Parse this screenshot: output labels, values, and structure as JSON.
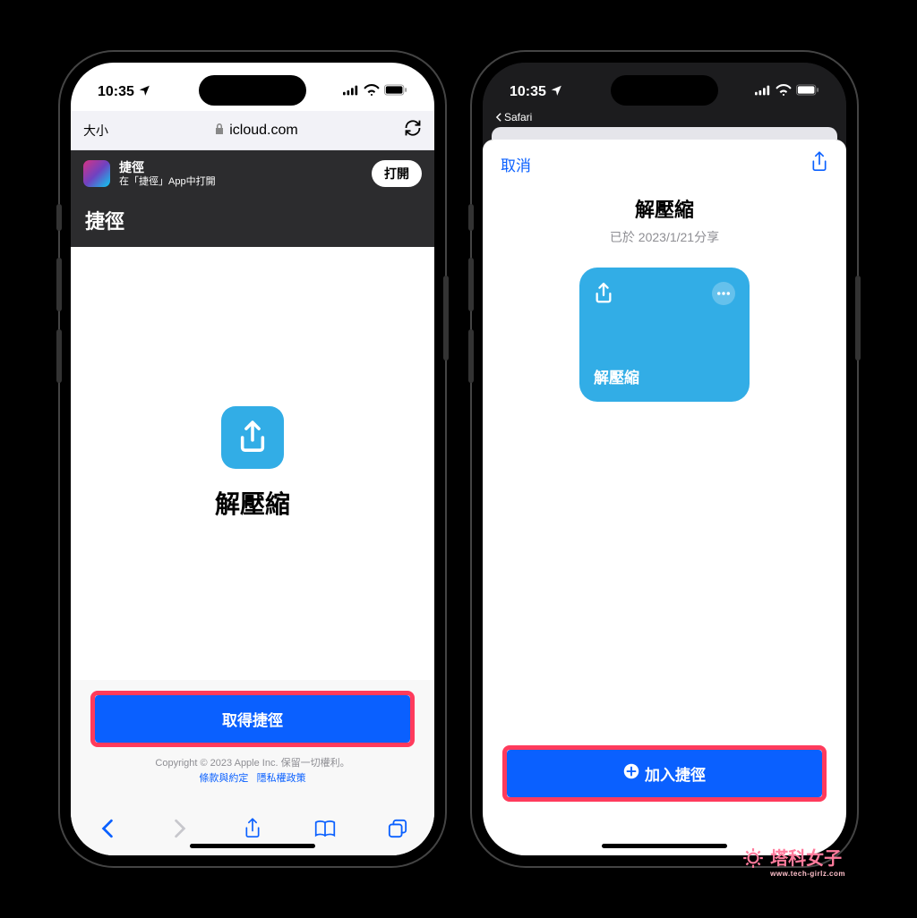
{
  "status": {
    "time": "10:35"
  },
  "phone1": {
    "url_size": "大小",
    "url_domain": "icloud.com",
    "banner_title": "捷徑",
    "banner_sub": "在「捷徑」App中打開",
    "banner_open": "打開",
    "header": "捷徑",
    "shortcut_name": "解壓縮",
    "get_button": "取得捷徑",
    "copyright": "Copyright © 2023 Apple Inc. 保留一切權利。",
    "terms": "條款與約定",
    "privacy": "隱私權政策"
  },
  "phone2": {
    "back_app": "Safari",
    "cancel": "取消",
    "title": "解壓縮",
    "shared_on": "已於 2023/1/21分享",
    "card_label": "解壓縮",
    "add_button": "加入捷徑"
  },
  "watermark": {
    "main": "塔科女子",
    "sub": "www.tech-girlz.com"
  }
}
